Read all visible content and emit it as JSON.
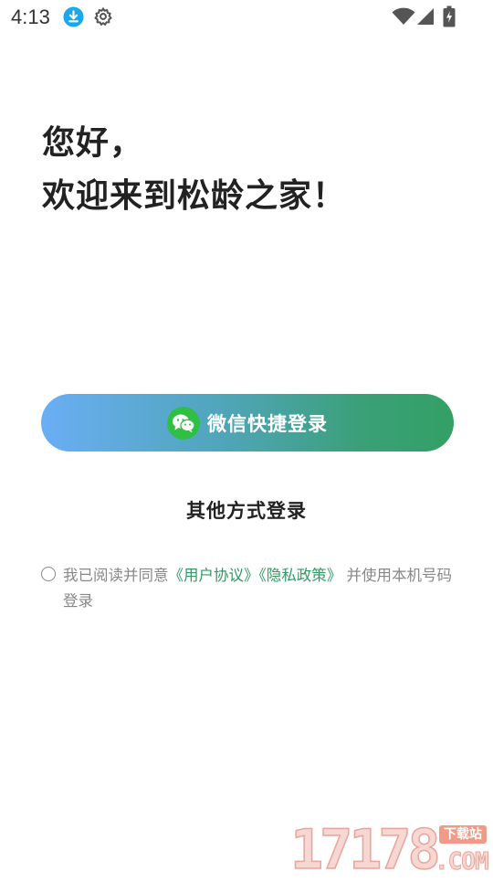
{
  "status_bar": {
    "time": "4:13",
    "icons": [
      "download-icon",
      "gear-icon",
      "wifi-icon",
      "signal-icon",
      "battery-charging-icon"
    ]
  },
  "greeting": {
    "line1": "您好，",
    "line2": "欢迎来到松龄之家！"
  },
  "login": {
    "wechat_label": "微信快捷登录",
    "other_label": "其他方式登录"
  },
  "agreement": {
    "prefix": "我已阅读并同意",
    "user_agreement": "《用户协议》",
    "privacy_policy": "《隐私政策》",
    "suffix": " 并使用本机号码登录",
    "checked": false
  },
  "watermark": {
    "number": "17178",
    "badge": "下载站",
    "domain": ".COM"
  },
  "colors": {
    "gradient_start": "#6aaef5",
    "gradient_end": "#33a066",
    "link": "#2f9a63",
    "wechat_green": "#2fbf45"
  }
}
